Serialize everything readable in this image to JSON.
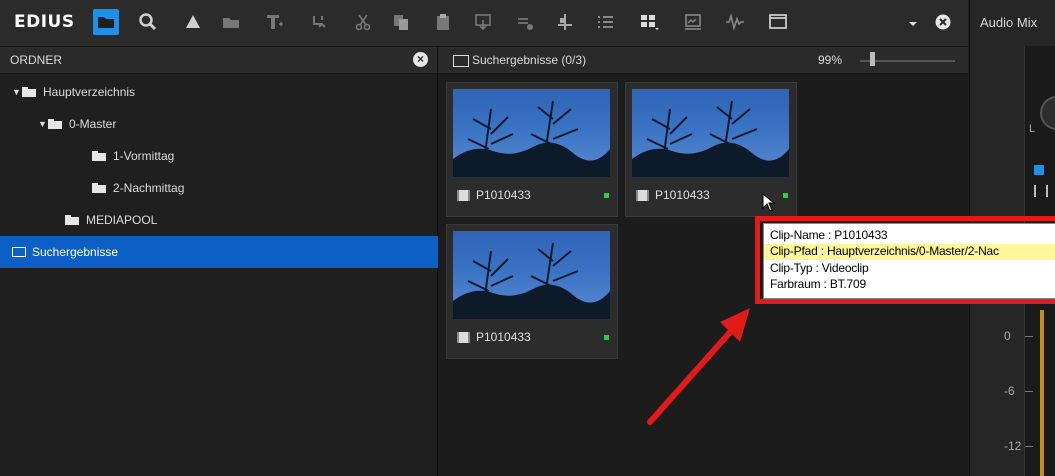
{
  "app": {
    "logo": "EDIUS",
    "accent_color": "#1f8fe8",
    "selection_color": "#0c5fc4"
  },
  "toolbar": {
    "icons": [
      "folder-icon",
      "search-icon",
      "upload-icon",
      "folder-open-icon",
      "new-sequence-icon",
      "import-icon",
      "cut-icon",
      "copy-icon",
      "paste-icon",
      "insert-icon",
      "mix-icon",
      "split-icon",
      "list-view-icon",
      "grid-view-icon",
      "export-icon",
      "waveform-icon",
      "window-icon",
      "dropdown-icon",
      "close-icon"
    ]
  },
  "folder_panel": {
    "title": "ORDNER",
    "tree": [
      {
        "label": "Hauptverzeichnis",
        "expanded": true,
        "level": 0
      },
      {
        "label": "0-Master",
        "expanded": true,
        "level": 1
      },
      {
        "label": "1-Vormittag",
        "level": 2
      },
      {
        "label": "2-Nachmittag",
        "level": 2
      },
      {
        "label": "MEDIAPOOL",
        "level": 1
      },
      {
        "label": "Suchergebnisse",
        "level": 0,
        "selected": true
      }
    ]
  },
  "bin": {
    "title": "Suchergebnisse (0/3)",
    "zoom": "99%",
    "clips": [
      {
        "name": "P1010433"
      },
      {
        "name": "P1010433"
      },
      {
        "name": "P1010433"
      }
    ]
  },
  "tooltip": {
    "lines": [
      "Clip-Name : P1010433",
      "Clip-Pfad : Hauptverzeichnis/0-Master/2-Nac",
      "Clip-Typ : Videoclip",
      "Farbraum : BT.709"
    ]
  },
  "audio_mixer": {
    "title": "Audio Mix",
    "channel_label": "L",
    "db_scale": [
      "0",
      "-6",
      "-12"
    ]
  }
}
